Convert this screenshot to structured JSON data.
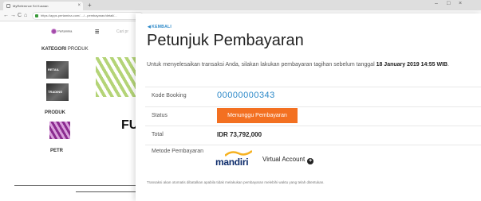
{
  "browser": {
    "tab_title": "MyReference Sri Kusnan",
    "tab_close": "×",
    "new_tab": "+",
    "minimize": "–",
    "maximize": "□",
    "close": "×",
    "back": "←",
    "forward": "→",
    "reload": "C",
    "home": "⌂",
    "url": "https://apps.pertamina.com/..../...pembayaran/detail/..."
  },
  "background_page": {
    "logo_text": "Pertamina",
    "menu_icon": "☰",
    "search_placeholder": "Cari pr",
    "kategori_bold": "KATEGORI",
    "kategori_rest": " PRODUK",
    "tiles": [
      "RETAIL",
      "TRADING"
    ],
    "produk_label": "PRODUK",
    "hero_text": "FU",
    "product_name": "PETR"
  },
  "modal": {
    "back_label": "KEMBALI",
    "title": "Petunjuk Pembayaran",
    "intro_text": "Untuk menyelesaikan transaksi Anda, silakan lakukan pembayaran tagihan sebelum tanggal ",
    "deadline": "18 January 2019 14:55 WIB",
    "intro_end": ".",
    "rows": {
      "booking": {
        "label": "Kode Booking",
        "value": "00000000343"
      },
      "status": {
        "label": "Status",
        "value": "Menunggu Pembayaran"
      },
      "total": {
        "label": "Total",
        "value": "IDR 73,792,000"
      },
      "method": {
        "label": "Metode Pembayaran",
        "bank": "mandiri",
        "value": "Virtual Account"
      }
    },
    "note": "Transaksi akan otomatis dibatalkan apabila tidak melakukan pembayaran melebihi waktu yang telah ditentukan.",
    "colors": {
      "accent_blue": "#2b88c8",
      "status_orange": "#f37021",
      "mandiri_navy": "#0d2c6b",
      "mandiri_gold": "#f6b221"
    }
  }
}
